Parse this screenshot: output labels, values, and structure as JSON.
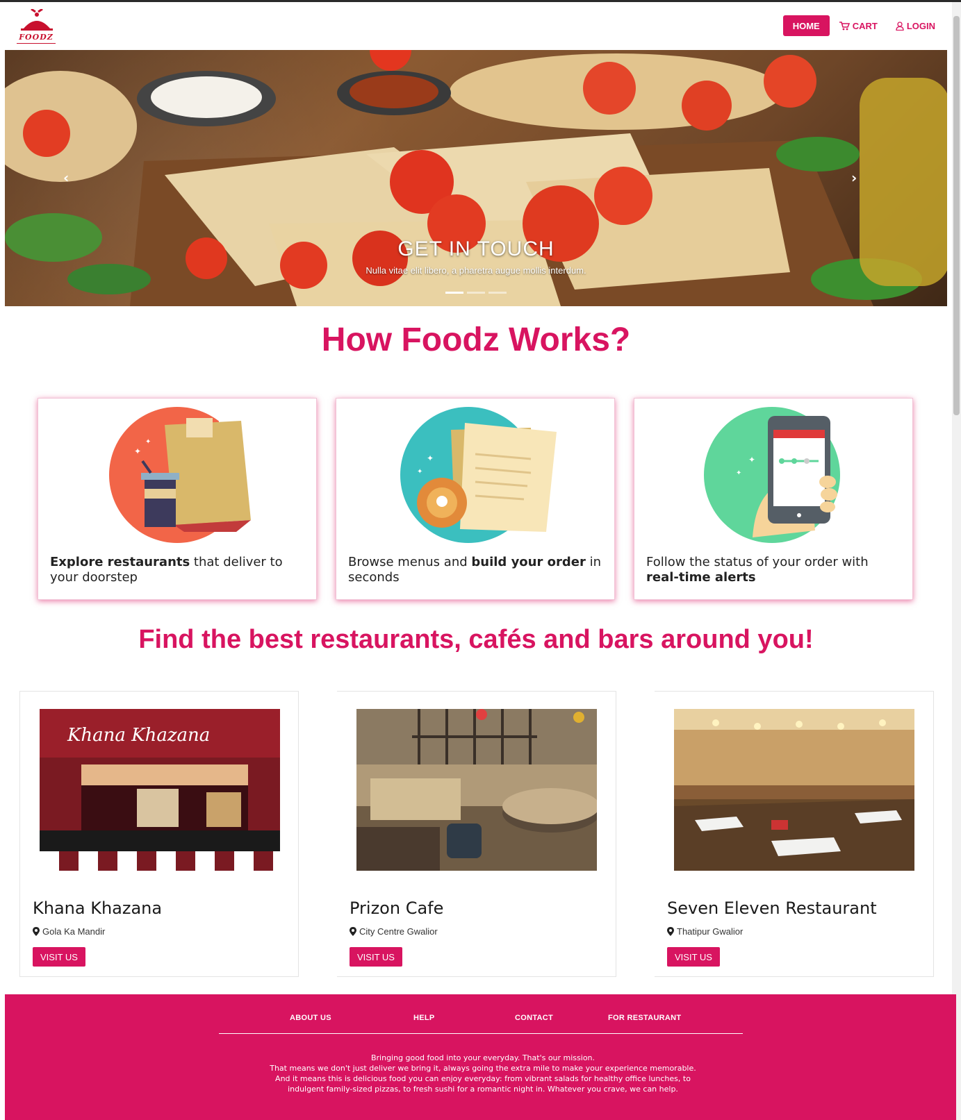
{
  "brand": {
    "name": "FOODZ",
    "accent": "#d81460"
  },
  "nav": {
    "home": "HOME",
    "cart": "CART",
    "login": "LOGIN"
  },
  "hero": {
    "title": "GET IN TOUCH",
    "subtitle": "Nulla vitae elit libero, a pharetra augue mollis interdum.",
    "slides": 3,
    "active_slide": 1
  },
  "how": {
    "heading": "How Foodz Works?",
    "cards": [
      {
        "icon": "food-bag-icon",
        "bold": "Explore restaurants",
        "text": " that deliver to your doorstep"
      },
      {
        "icon": "menu-icon",
        "pre": "Browse menus and ",
        "bold": "build your order",
        "text": " in seconds"
      },
      {
        "icon": "phone-icon",
        "pre": "Follow the status of your order with ",
        "bold": "real-time alerts"
      }
    ]
  },
  "find": {
    "heading": "Find the best restaurants, cafés and bars around you!",
    "restaurants": [
      {
        "name": "Khana Khazana",
        "location": "Gola Ka Mandir",
        "button": "VISIT US",
        "sign": "Khana  Khazana"
      },
      {
        "name": "Prizon Cafe",
        "location": "City Centre Gwalior",
        "button": "VISIT US"
      },
      {
        "name": "Seven Eleven Restaurant",
        "location": "Thatipur Gwalior",
        "button": "VISIT US"
      }
    ]
  },
  "footer": {
    "links": [
      "ABOUT US",
      "HELP",
      "CONTACT",
      "FOR RESTAURANT"
    ],
    "lines": [
      "Bringing good food into your everyday. That's our mission.",
      "That means we don't just deliver we bring it, always going the extra mile to make your experience memorable.",
      "And it means this is delicious food you can enjoy everyday: from vibrant salads for healthy office lunches, to indulgent family-sized pizzas, to fresh sushi for a romantic night in. Whatever you crave, we can help."
    ]
  }
}
